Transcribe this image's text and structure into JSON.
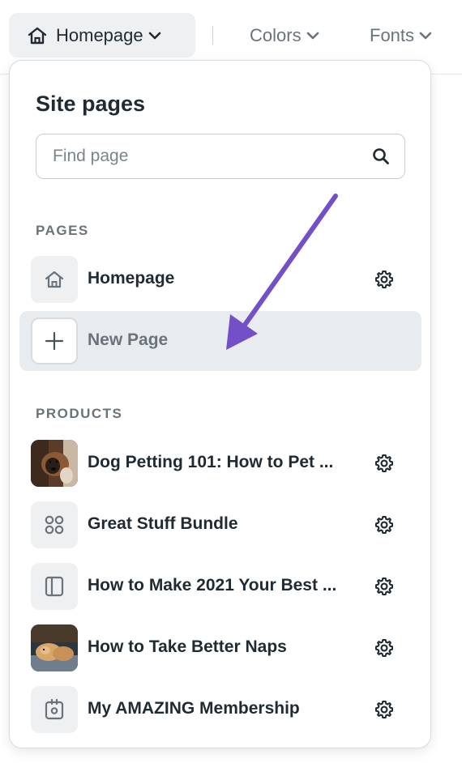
{
  "topnav": {
    "homepage_label": "Homepage",
    "colors_label": "Colors",
    "fonts_label": "Fonts"
  },
  "panel": {
    "title": "Site pages",
    "search_placeholder": "Find page"
  },
  "sections": {
    "pages_label": "PAGES",
    "products_label": "PRODUCTS"
  },
  "pages": [
    {
      "label": "Homepage",
      "icon": "home-icon"
    },
    {
      "label": "New Page",
      "icon": "plus-icon"
    }
  ],
  "products": [
    {
      "label": "Dog Petting 101: How to Pet ...",
      "icon": "dog-photo-thumbnail"
    },
    {
      "label": "Great Stuff Bundle",
      "icon": "bundle-grid-icon"
    },
    {
      "label": "How to Make 2021 Your Best ...",
      "icon": "course-sidebar-icon"
    },
    {
      "label": "How to Take Better Naps",
      "icon": "puppy-photo-thumbnail"
    },
    {
      "label": "My AMAZING Membership",
      "icon": "membership-icon"
    }
  ],
  "colors": {
    "text": "#1f2a33",
    "muted": "#6a737b",
    "hover_row": "#e9ecef",
    "annotation_arrow": "#7450c8"
  }
}
